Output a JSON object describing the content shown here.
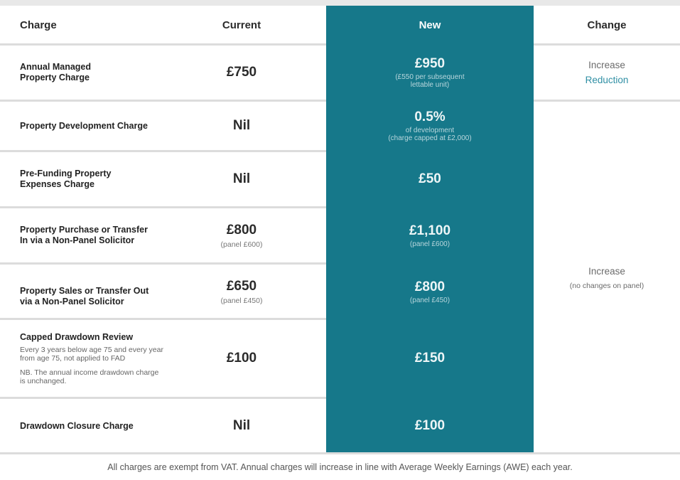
{
  "headers": {
    "charge": "Charge",
    "current": "Current",
    "new": "New",
    "change": "Change"
  },
  "rows": [
    {
      "label": "Annual Managed\nProperty Charge",
      "current": "£750",
      "current_note": "",
      "new": "£950",
      "new_note": "(£550 per subsequent\nlettable unit)"
    },
    {
      "label": "Property Development Charge",
      "current": "Nil",
      "current_note": "",
      "new": "0.5%",
      "new_note": "of development\n(charge capped at £2,000)"
    },
    {
      "label": "Pre-Funding Property\nExpenses  Charge",
      "current": "Nil",
      "current_note": "",
      "new": "£50",
      "new_note": ""
    },
    {
      "label": "Property Purchase or Transfer\nIn via a Non-Panel Solicitor",
      "current": "£800",
      "current_note": "(panel £600)",
      "new": "£1,100",
      "new_note": "(panel £600)"
    },
    {
      "label": "Property Sales or Transfer Out\nvia a Non-Panel Solicitor",
      "current": "£650",
      "current_note": "(panel £450)",
      "new": "£800",
      "new_note": "(panel £450)"
    },
    {
      "label": "Capped Drawdown Review",
      "label_sub1": "Every 3 years below age 75 and every year\nfrom age 75, not applied to FAD",
      "label_sub2": "NB. The annual income drawdown charge\nis unchanged.",
      "current": "£100",
      "current_note": "",
      "new": "£150",
      "new_note": ""
    },
    {
      "label": "Drawdown Closure Charge",
      "current": "Nil",
      "current_note": "",
      "new": "£100",
      "new_note": ""
    }
  ],
  "change": {
    "row1_line1": "Increase",
    "row1_line2": "Reduction",
    "group_line1": "Increase",
    "group_line2": "(no changes on panel)"
  },
  "footer": "All charges are exempt from VAT. Annual charges will increase in line with Average Weekly Earnings (AWE) each year.",
  "colors": {
    "new_column": "#16788a",
    "reduction_text": "#2f8fa4"
  }
}
